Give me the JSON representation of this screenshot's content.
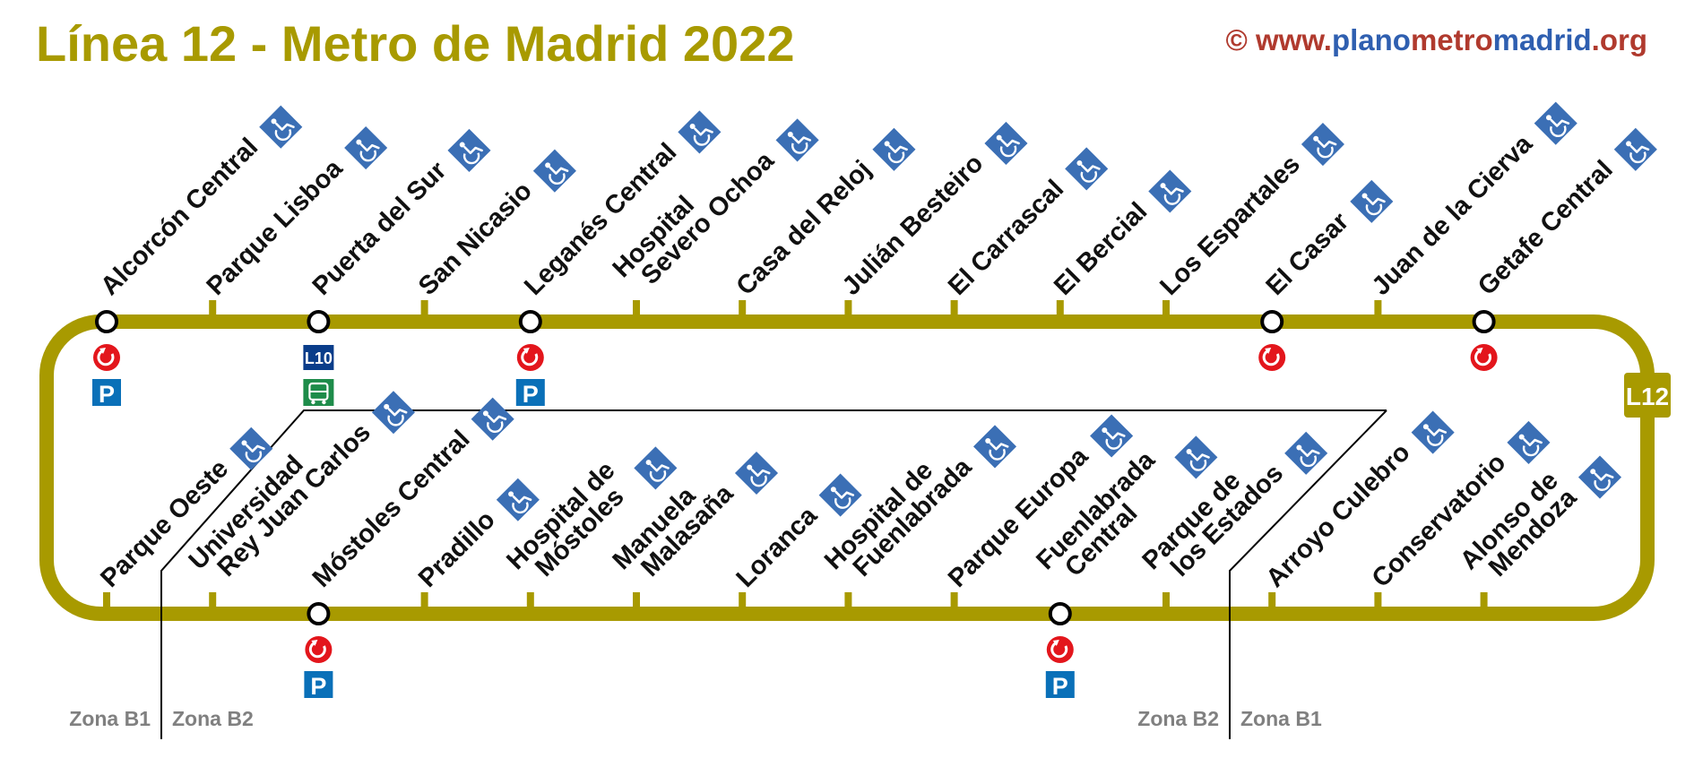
{
  "title": "Línea 12 - Metro de Madrid 2022",
  "credit": {
    "copyright": "©",
    "www": "www.",
    "plano": "plano",
    "metro": "metro",
    "madrid": "madrid",
    "org": ".org"
  },
  "colors": {
    "line": "#a89a00",
    "title": "#a89a00",
    "credit_red": "#b03a2e",
    "credit_blue": "#2f5fb0",
    "accessible": "#3b6fb5",
    "renfe": "#e3161c",
    "parking": "#0a70b8",
    "l10": "#0a3d8a",
    "bus": "#1e8c4a",
    "zone_text": "#808080"
  },
  "line_badge": "L12",
  "badge_labels": {
    "l10": "L10",
    "parking": "P"
  },
  "icons": {
    "accessible": "wheelchair-icon",
    "renfe": "renfe-cercanias-icon",
    "parking": "parking-icon",
    "bus": "bus-icon"
  },
  "stations_top": [
    {
      "name": [
        "Alcorcón Central"
      ],
      "accessible": true,
      "interchange": true,
      "services": [
        "renfe",
        "parking"
      ]
    },
    {
      "name": [
        "Parque Lisboa"
      ],
      "accessible": true
    },
    {
      "name": [
        "Puerta del Sur"
      ],
      "accessible": true,
      "interchange": true,
      "services": [
        "l10",
        "bus"
      ]
    },
    {
      "name": [
        "San Nicasio"
      ],
      "accessible": true
    },
    {
      "name": [
        "Leganés Central"
      ],
      "accessible": true,
      "interchange": true,
      "services": [
        "renfe",
        "parking"
      ]
    },
    {
      "name": [
        "Hospital",
        "Severo Ochoa"
      ],
      "accessible": true
    },
    {
      "name": [
        "Casa del Reloj"
      ],
      "accessible": true
    },
    {
      "name": [
        "Julián Besteiro"
      ],
      "accessible": true
    },
    {
      "name": [
        "El Carrascal"
      ],
      "accessible": true
    },
    {
      "name": [
        "El Bercial"
      ],
      "accessible": true
    },
    {
      "name": [
        "Los Espartales"
      ],
      "accessible": true
    },
    {
      "name": [
        "El Casar"
      ],
      "accessible": true,
      "interchange": true,
      "services": [
        "renfe"
      ]
    },
    {
      "name": [
        "Juan de la Cierva"
      ],
      "accessible": true
    },
    {
      "name": [
        "Getafe Central"
      ],
      "accessible": true,
      "interchange": true,
      "services": [
        "renfe"
      ]
    }
  ],
  "stations_bottom": [
    {
      "name": [
        "Parque Oeste"
      ],
      "accessible": true
    },
    {
      "name": [
        "Universidad",
        "Rey Juan Carlos"
      ],
      "accessible": true
    },
    {
      "name": [
        "Móstoles Central"
      ],
      "accessible": true,
      "interchange": true,
      "services": [
        "renfe",
        "parking"
      ]
    },
    {
      "name": [
        "Pradillo"
      ],
      "accessible": true
    },
    {
      "name": [
        "Hospital de",
        "Móstoles"
      ],
      "accessible": true
    },
    {
      "name": [
        "Manuela",
        "Malasaña"
      ],
      "accessible": true
    },
    {
      "name": [
        "Loranca"
      ],
      "accessible": true
    },
    {
      "name": [
        "Hospital de",
        "Fuenlabrada"
      ],
      "accessible": true
    },
    {
      "name": [
        "Parque Europa"
      ],
      "accessible": true
    },
    {
      "name": [
        "Fuenlabrada",
        "Central"
      ],
      "accessible": true,
      "interchange": true,
      "services": [
        "renfe",
        "parking"
      ]
    },
    {
      "name": [
        "Parque de",
        "los Estados"
      ],
      "accessible": true
    },
    {
      "name": [
        "Arroyo Culebro"
      ],
      "accessible": true
    },
    {
      "name": [
        "Conservatorio"
      ],
      "accessible": true
    },
    {
      "name": [
        "Alonso de",
        "Mendoza"
      ],
      "accessible": true
    }
  ],
  "zones": {
    "left_b1": "Zona B1",
    "left_b2": "Zona B2",
    "right_b2": "Zona B2",
    "right_b1": "Zona B1"
  }
}
